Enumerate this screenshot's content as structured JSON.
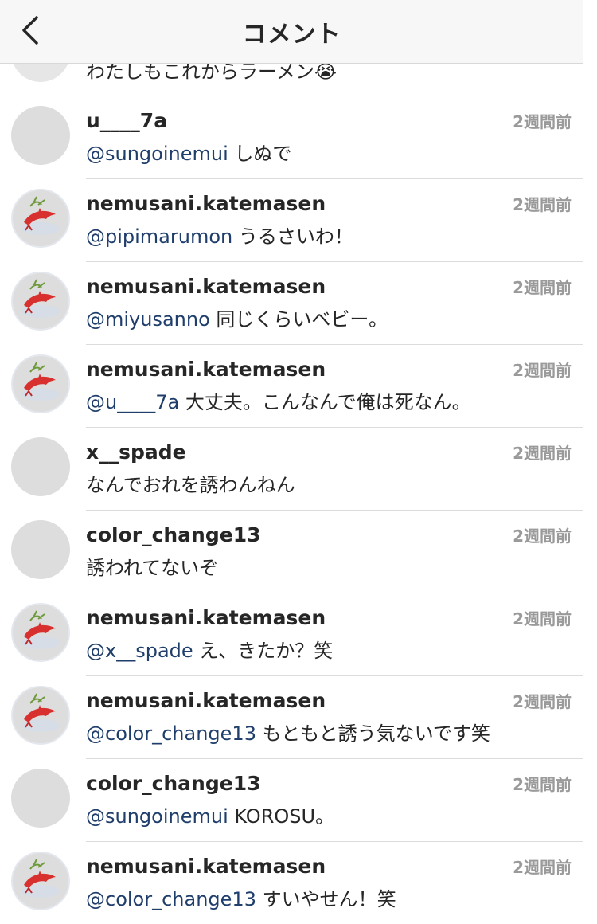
{
  "header": {
    "title": "コメント"
  },
  "partial_comment": {
    "text": "わたしもこれからラーメン😭"
  },
  "comments": [
    {
      "user": "u____7a",
      "mention": "@sungoinemui",
      "text": " しぬで",
      "time": "2週間前",
      "avatar": "cat-avatar"
    },
    {
      "user": "nemusani.katemasen",
      "mention": "@pipimarumon",
      "text": " うるさいわ！",
      "time": "2週間前",
      "avatar": "logo-avatar"
    },
    {
      "user": "nemusani.katemasen",
      "mention": "@miyusanno",
      "text": " 同じくらいベビー。",
      "time": "2週間前",
      "avatar": "logo-avatar"
    },
    {
      "user": "nemusani.katemasen",
      "mention": "@u____7a",
      "text": " 大丈夫。こんなんで俺は死なん。",
      "time": "2週間前",
      "avatar": "logo-avatar"
    },
    {
      "user": "x__spade",
      "mention": "",
      "text": "なんでおれを誘わんねん",
      "time": "2週間前",
      "avatar": "night-city-avatar"
    },
    {
      "user": "color_change13",
      "mention": "",
      "text": "誘われてないぞ",
      "time": "2週間前",
      "avatar": "crowd-avatar"
    },
    {
      "user": "nemusani.katemasen",
      "mention": "@x__spade",
      "text": " え、きたか？笑",
      "time": "2週間前",
      "avatar": "logo-avatar"
    },
    {
      "user": "nemusani.katemasen",
      "mention": "@color_change13",
      "text": " もともと誘う気ないです笑",
      "time": "2週間前",
      "avatar": "logo-avatar"
    },
    {
      "user": "color_change13",
      "mention": "@sungoinemui",
      "text": " KOROSU。",
      "time": "2週間前",
      "avatar": "crowd-avatar"
    },
    {
      "user": "nemusani.katemasen",
      "mention": "@color_change13",
      "text": " すいやせん！笑",
      "time": "2週間前",
      "avatar": "logo-avatar"
    }
  ],
  "colors": {
    "mention": "#1f3e6b",
    "time": "#9a9a9a",
    "header_bg": "#f7f7f7"
  }
}
